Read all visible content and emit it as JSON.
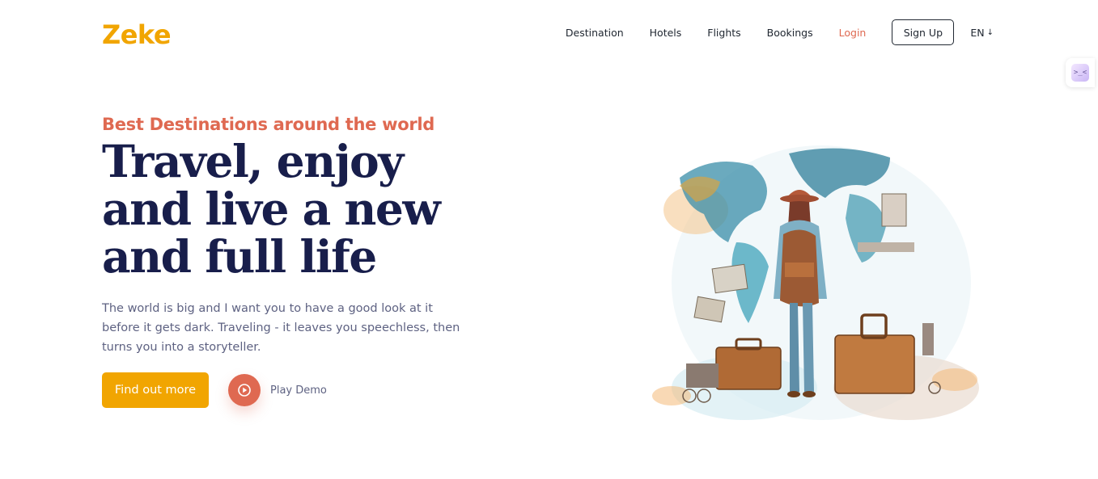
{
  "brand": {
    "logo": "Zeke"
  },
  "nav": {
    "links": [
      "Destination",
      "Hotels",
      "Flights",
      "Bookings",
      "Login"
    ],
    "signup": "Sign Up",
    "language": "EN"
  },
  "hero": {
    "tagline": "Best Destinations around the world",
    "headline_lines": [
      "Travel, enjoy",
      "and live a new",
      "and full life"
    ],
    "description": "The world is big and I want you to have a good look at it before it gets dark. Traveling - it leaves you speechless, then turns you into a storyteller.",
    "cta": "Find out more",
    "play_label": "Play Demo"
  },
  "extension": {
    "glyph": ">_<"
  },
  "colors": {
    "brand_yellow": "#F1A501",
    "accent_orange": "#DF6951",
    "heading_navy": "#181E4B",
    "body_gray": "#5E6282"
  },
  "icons": [
    "play-icon",
    "chevron-down-icon",
    "extension-icon"
  ]
}
